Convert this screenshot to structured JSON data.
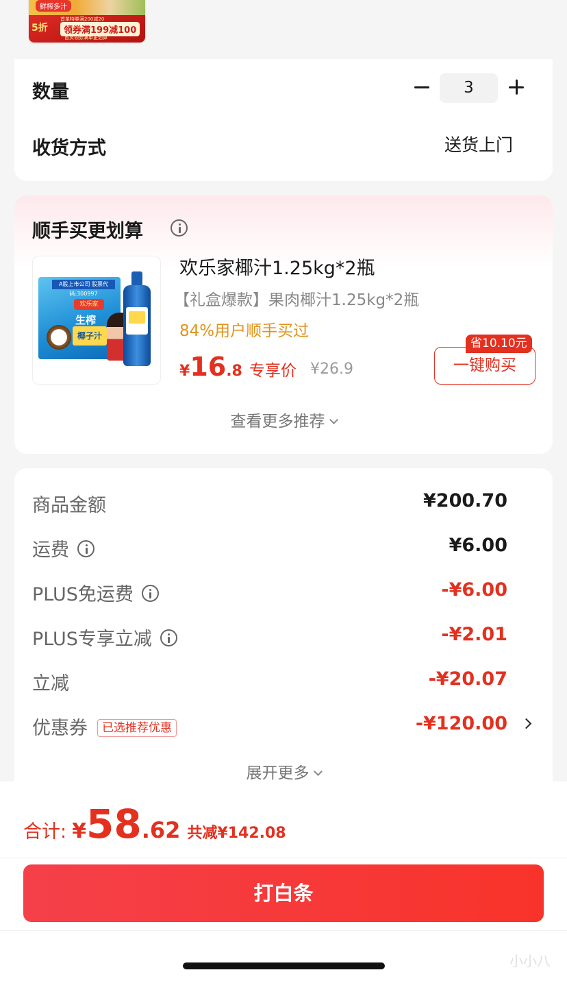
{
  "banner": {
    "tag": "鲜榨多汁",
    "line": "首单特券满200减20",
    "discount": "5折",
    "coupon": "领券满199减100",
    "foot": "首页领券满单更划算"
  },
  "order": {
    "quantity_label": "数量",
    "quantity_value": "3",
    "delivery_label": "收货方式",
    "delivery_value": "送货上门"
  },
  "recommend": {
    "title": "顺手买更划算",
    "product": {
      "name": "欢乐家椰汁1.25kg*2瓶",
      "subtitle": "【礼盒爆款】果肉椰汁1.25kg*2瓶",
      "social": "84%用户顺手买过",
      "price_currency": "¥",
      "price_int": "16",
      "price_dec": ".8",
      "price_tag": "专享价",
      "original_price": "¥26.9",
      "save_badge": "省10.10元",
      "buy_label": "一键购买",
      "box_band": "A股上市公司 股票代码:300997",
      "box_logo": "欢乐家",
      "box_name": "生榨",
      "box_name2": "椰子汁"
    },
    "more_label": "查看更多推荐"
  },
  "fees": {
    "rows": [
      {
        "label": "商品金额",
        "value": "¥200.70"
      },
      {
        "label": "运费",
        "value": "¥6.00"
      },
      {
        "label": "PLUS免运费",
        "value": "-¥6.00"
      },
      {
        "label": "PLUS专享立减",
        "value": "-¥2.01"
      },
      {
        "label": "立减",
        "value": "-¥20.07"
      },
      {
        "label": "优惠券",
        "tag": "已选推荐优惠",
        "value": "-¥120.00"
      }
    ],
    "expand_label": "展开更多"
  },
  "footer": {
    "total_label": "合计:",
    "total_currency": "¥",
    "total_int": "58",
    "total_dec": ".62",
    "saved_label": "共减¥142.08",
    "pay_button": "打白条",
    "watermark": "小小八"
  },
  "colors": {
    "accent": "#e4301f",
    "social": "#e2931a",
    "muted": "#888888"
  }
}
